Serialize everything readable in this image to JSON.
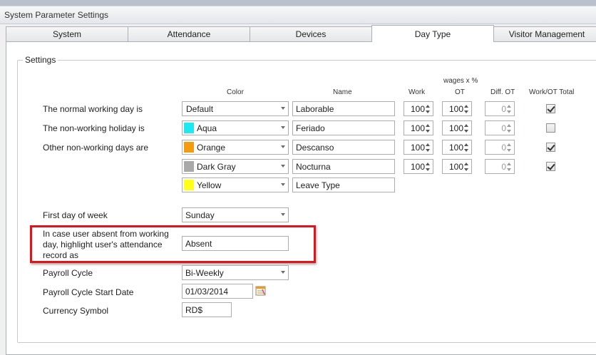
{
  "window": {
    "title": "System Parameter Settings"
  },
  "tabs": [
    {
      "label": "System"
    },
    {
      "label": "Attendance"
    },
    {
      "label": "Devices"
    },
    {
      "label": "Day Type"
    },
    {
      "label": "Visitor Management"
    }
  ],
  "settings": {
    "group_title": "Settings",
    "headers": {
      "wages": "wages x %",
      "color": "Color",
      "name": "Name",
      "work": "Work",
      "ot": "OT",
      "diff_ot": "Diff. OT",
      "work_ot_total": "Work/OT Total"
    },
    "rows": [
      {
        "label": "The normal working day is",
        "color": "Default",
        "swatch": "",
        "name": "Laborable",
        "work": "100",
        "ot": "100",
        "diff_ot": "0",
        "total_checked": true
      },
      {
        "label": "The non-working holiday is",
        "color": "Aqua",
        "swatch": "#1ee8f0",
        "name": "Feriado",
        "work": "100",
        "ot": "100",
        "diff_ot": "0",
        "total_checked": false
      },
      {
        "label": "Other non-working days are",
        "color": "Orange",
        "swatch": "#f39c12",
        "name": "Descanso",
        "work": "100",
        "ot": "100",
        "diff_ot": "0",
        "total_checked": true
      },
      {
        "label": "",
        "color": "Dark Gray",
        "swatch": "#a9a9a9",
        "name": "Nocturna",
        "work": "100",
        "ot": "100",
        "diff_ot": "0",
        "total_checked": true
      },
      {
        "label": "",
        "color": "Yellow",
        "swatch": "#ffff1a",
        "name": "Leave Type"
      }
    ],
    "first_day": {
      "label": "First day of week",
      "value": "Sunday"
    },
    "absent": {
      "label_lines": [
        "In case user absent from working",
        "day, highlight user's attendance",
        "record as"
      ],
      "value": "Absent"
    },
    "payroll_cycle": {
      "label": "Payroll Cycle",
      "value": "Bi-Weekly"
    },
    "payroll_start": {
      "label": "Payroll Cycle Start Date",
      "value": "01/03/2014"
    },
    "currency": {
      "label": "Currency Symbol",
      "value": "RD$"
    }
  },
  "colors": {
    "highlight_box": "#e0141b"
  },
  "icons": {
    "date_picker": "calendar-icon"
  }
}
